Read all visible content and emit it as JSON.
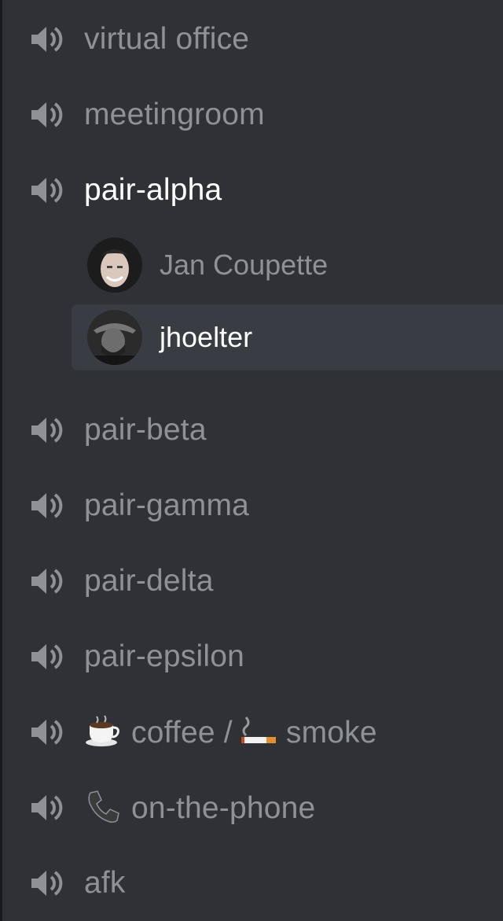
{
  "voice_channels": [
    {
      "label": "virtual office",
      "icon": "speaker-icon"
    },
    {
      "label": "meetingroom",
      "icon": "speaker-icon"
    },
    {
      "label": "pair-alpha",
      "icon": "speaker-icon",
      "active": true,
      "members": [
        {
          "name": "Jan Coupette",
          "avatar": "avatar-jan"
        },
        {
          "name": "jhoelter",
          "avatar": "avatar-jhoelter",
          "selected": true
        }
      ]
    },
    {
      "label": "pair-beta",
      "icon": "speaker-icon"
    },
    {
      "label": "pair-gamma",
      "icon": "speaker-icon"
    },
    {
      "label": "pair-delta",
      "icon": "speaker-icon"
    },
    {
      "label": "pair-epsilon",
      "icon": "speaker-icon"
    },
    {
      "label": "coffee / ",
      "label_b": " smoke",
      "icon": "speaker-icon",
      "emoji_a": "coffee-cup-icon",
      "emoji_b": "cigarette-icon"
    },
    {
      "label": "on-the-phone",
      "icon": "speaker-icon",
      "emoji_a": "telephone-icon"
    },
    {
      "label": "afk",
      "icon": "speaker-icon"
    }
  ],
  "colors": {
    "background": "#2f3136",
    "text_muted": "#8e9297",
    "text_active": "#ffffff",
    "selected_row": "#393c43"
  }
}
